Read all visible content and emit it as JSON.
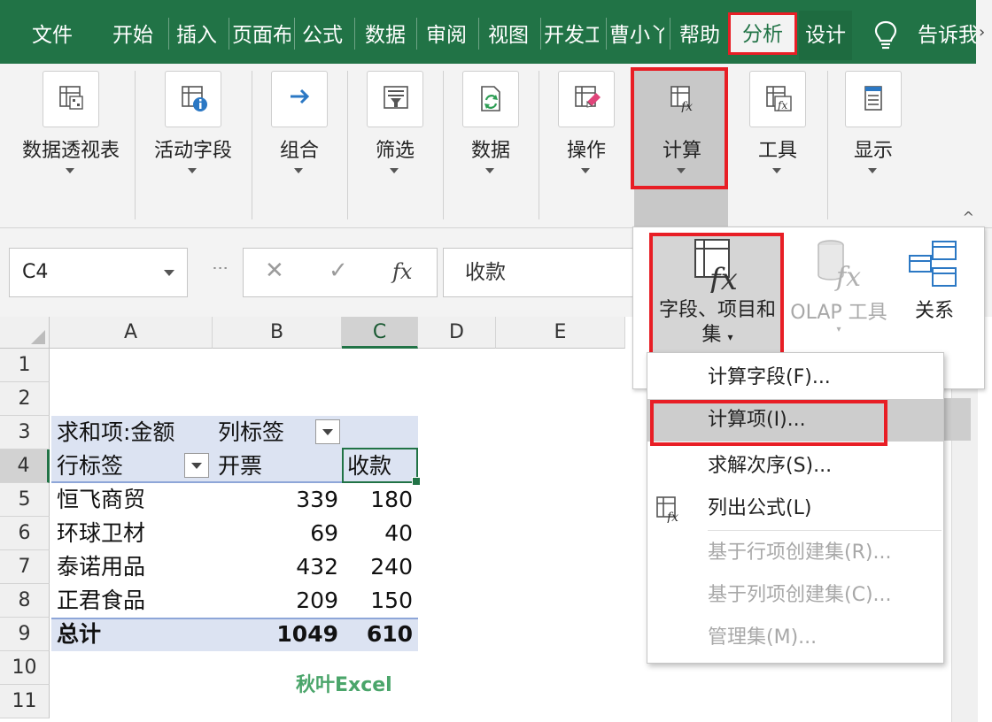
{
  "tabs": [
    {
      "label": "文件",
      "active": false
    },
    {
      "label": "开始",
      "active": false
    },
    {
      "label": "插入",
      "active": false
    },
    {
      "label": "页面布局",
      "active": false
    },
    {
      "label": "公式",
      "active": false
    },
    {
      "label": "数据",
      "active": false
    },
    {
      "label": "审阅",
      "active": false
    },
    {
      "label": "视图",
      "active": false
    },
    {
      "label": "开发工具",
      "active": false
    },
    {
      "label": "曹小丫",
      "active": false
    },
    {
      "label": "帮助",
      "active": false
    },
    {
      "label": "分析",
      "active": true
    },
    {
      "label": "设计",
      "active": false
    },
    {
      "label": "告诉我",
      "active": false
    }
  ],
  "ribbon": {
    "groups": [
      {
        "label": "数据透视表",
        "icon": "pivot-table-icon"
      },
      {
        "label": "活动字段",
        "icon": "active-field-icon"
      },
      {
        "label": "组合",
        "icon": "group-arrow-icon"
      },
      {
        "label": "筛选",
        "icon": "filter-icon"
      },
      {
        "label": "数据",
        "icon": "refresh-data-icon"
      },
      {
        "label": "操作",
        "icon": "actions-icon"
      },
      {
        "label": "计算",
        "icon": "calculations-icon"
      },
      {
        "label": "工具",
        "icon": "tools-icon"
      },
      {
        "label": "显示",
        "icon": "show-icon"
      }
    ],
    "collapse_caret": "^"
  },
  "formula_bar": {
    "name_box": "C4",
    "cancel": "✕",
    "confirm": "✓",
    "fx": "fx",
    "value": "收款"
  },
  "columns": [
    "A",
    "B",
    "C",
    "D",
    "E"
  ],
  "rows": [
    "1",
    "2",
    "3",
    "4",
    "5",
    "6",
    "7",
    "8",
    "9",
    "10",
    "11"
  ],
  "pivot": {
    "values_label": "求和项:金额",
    "col_label": "列标签",
    "row_label": "行标签",
    "col1": "开票",
    "col2": "收款",
    "data": [
      {
        "name": "恒飞商贸",
        "b": "339",
        "c": "180"
      },
      {
        "name": "环球卫材",
        "b": "69",
        "c": "40"
      },
      {
        "name": "泰诺用品",
        "b": "432",
        "c": "240"
      },
      {
        "name": "正君食品",
        "b": "209",
        "c": "150"
      }
    ],
    "total_label": "总计",
    "total_b": "1049",
    "total_c": "610"
  },
  "watermark": "秋叶Excel",
  "calc_panel": {
    "fields_items_sets": "字段、项目和集",
    "fields_items_sets_line1": "字段、项目和",
    "fields_items_sets_line2": "集",
    "olap_tools": "OLAP 工具",
    "relationships": "关系"
  },
  "menu": {
    "items": [
      {
        "label": "计算字段(F)...",
        "disabled": false
      },
      {
        "label": "计算项(I)...",
        "disabled": false,
        "highlighted": true
      },
      {
        "label": "求解次序(S)...",
        "disabled": false
      },
      {
        "label": "列出公式(L)",
        "disabled": false
      },
      {
        "label": "基于行项创建集(R)...",
        "disabled": true
      },
      {
        "label": "基于列项创建集(C)...",
        "disabled": true
      },
      {
        "label": "管理集(M)...",
        "disabled": true
      }
    ]
  },
  "colors": {
    "excel_green": "#217346",
    "highlight_red": "#e81e25",
    "pivot_band": "#dce3f2"
  }
}
